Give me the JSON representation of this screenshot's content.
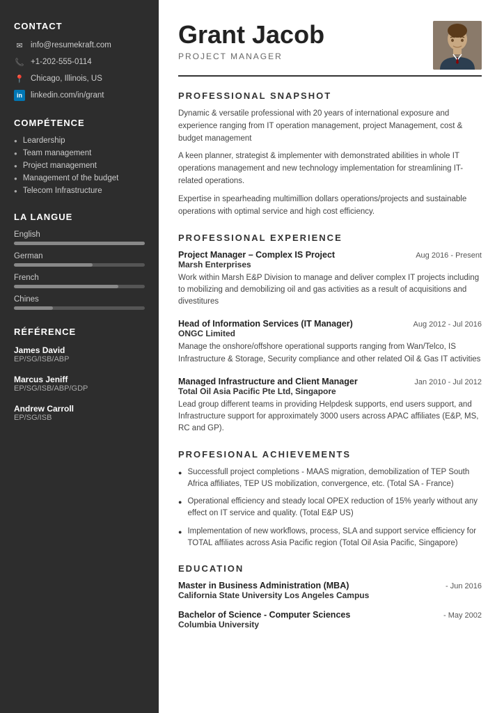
{
  "sidebar": {
    "contact_title": "CONTACT",
    "contact_items": [
      {
        "icon": "email",
        "text": "info@resumekraft.com"
      },
      {
        "icon": "phone",
        "text": "+1-202-555-0114"
      },
      {
        "icon": "location",
        "text": "Chicago, Illinois, US"
      },
      {
        "icon": "linkedin",
        "text": "linkedin.com/in/grant"
      }
    ],
    "competence_title": "COMPÉTENCE",
    "competence_items": [
      "Leardership",
      "Team management",
      "Project management",
      "Management of the budget",
      "Telecom Infrastructure"
    ],
    "langue_title": "LA LANGUE",
    "langues": [
      {
        "label": "English",
        "percent": 100
      },
      {
        "label": "German",
        "percent": 60
      },
      {
        "label": "French",
        "percent": 80
      },
      {
        "label": "Chines",
        "percent": 30
      }
    ],
    "reference_title": "RÉFÉRENCE",
    "references": [
      {
        "name": "James David",
        "code": "EP/SG/ISB/ABP"
      },
      {
        "name": "Marcus Jeniff",
        "code": "EP/SG/ISB/ABP/GDP"
      },
      {
        "name": "Andrew Carroll",
        "code": "EP/SG/ISB"
      }
    ]
  },
  "main": {
    "name": "Grant Jacob",
    "title": "PROJECT MANAGER",
    "snapshot_title": "PROFESSIONAL SNAPSHOT",
    "snapshot_paras": [
      "Dynamic & versatile professional with  20 years of international exposure and experience ranging from IT operation management, project Management, cost & budget management",
      "A keen planner, strategist & implementer with demonstrated abilities in whole IT operations management and new technology implementation for streamlining IT-related operations.",
      "Expertise in spearheading multimillion dollars operations/projects and sustainable operations with optimal service and high cost efficiency."
    ],
    "experience_title": "PROFESSIONAL EXPERIENCE",
    "experiences": [
      {
        "job_title": "Project Manager – Complex IS Project",
        "date": "Aug 2016 - Present",
        "company": "Marsh Enterprises",
        "desc": "Work within Marsh E&P Division to manage and deliver complex IT projects including  to mobilizing and demobilizing oil and gas activities as a result of acquisitions and divestitures"
      },
      {
        "job_title": "Head of Information Services (IT Manager)",
        "date": "Aug 2012 - Jul 2016",
        "company": "ONGC Limited",
        "desc": "Manage the onshore/offshore operational supports ranging from Wan/Telco, IS Infrastructure & Storage, Security compliance and other related Oil & Gas IT activities"
      },
      {
        "job_title": "Managed Infrastructure and Client Manager",
        "date": "Jan 2010 - Jul 2012",
        "company": "Total Oil Asia Pacific Pte Ltd, Singapore",
        "desc": "Lead group different teams in providing Helpdesk supports, end users support, and Infrastructure support for approximately 3000 users across APAC affiliates (E&P, MS, RC and GP)."
      }
    ],
    "achievements_title": "PROFESIONAL ACHIEVEMENTS",
    "achievements": [
      "Successfull project completions - MAAS migration, demobilization of TEP South Africa affiliates, TEP US mobilization, convergence, etc. (Total SA - France)",
      "Operational efficiency and steady local OPEX reduction of 15% yearly without any effect on IT service and quality. (Total E&P US)",
      "Implementation of new workflows, process, SLA and support service efficiency for TOTAL affiliates across Asia Pacific region (Total Oil Asia Pacific, Singapore)"
    ],
    "education_title": "EDUCATION",
    "educations": [
      {
        "degree": "Master in Business Administration (MBA)",
        "date": "- Jun 2016",
        "school": "California State University Los Angeles Campus"
      },
      {
        "degree": "Bachelor of Science - Computer Sciences",
        "date": "- May 2002",
        "school": "Columbia University"
      }
    ]
  }
}
